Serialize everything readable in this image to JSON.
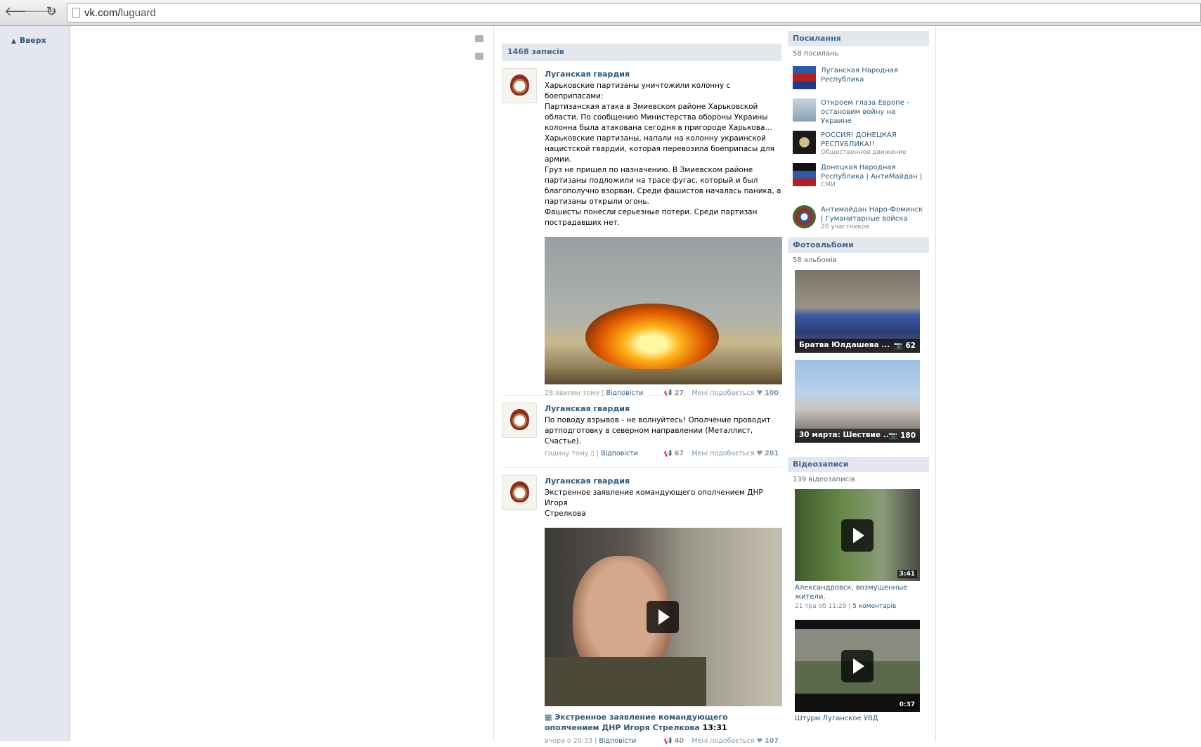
{
  "browser": {
    "url_host": "vk.com/",
    "url_path": "luguard",
    "back_glyph": "🡐",
    "forward_glyph": "🡒",
    "reload_glyph": "↻"
  },
  "left": {
    "up_label": "Вверх",
    "up_glyph": "▲"
  },
  "wall": {
    "count_label": "1468 записів",
    "posts": [
      {
        "author": "Луганская гвардия",
        "text": "Харьковские партизаны уничтожили колонну с боеприпасами:\nПартизанская атака в Змиевском районе Харьковской\nобласти. По сообщению Министерства обороны Украины\nколонна была атакована сегодня в пригороде Харькова…\nХарьковские партизаны, напали на колонну украинской\nнацистской гвардии, которая перевозила боеприпасы для\nармии.\nГруз не пришел по назначению. В Змиевском районе\nпартизаны подложили на трасе фугас, который и был\nблагополучно взорван. Среди фашистов началась паника, а\nпартизаны открыли огонь.\nФашисты понесли серьезные потери. Среди партизан\nпострадавших нет.",
        "time": "28 хвилин тому",
        "reply": "Відповісти",
        "shares": "27",
        "like_label": "Мені подобається",
        "likes": "100"
      },
      {
        "author": "Луганская гвардия",
        "text": "По поводу взрывов - не волнуйтесь! Ополчение проводит\nартподготовку в северном направлении (Металлист,\nСчастье).",
        "time": "годину тому",
        "reply": "Відповісти",
        "shares": "67",
        "like_label": "Мені подобається",
        "likes": "201"
      },
      {
        "author": "Луганская гвардия",
        "text": "Экстренное заявление командующего ополчением ДНР Игоря\nСтрелкова",
        "video_title": "Экстренное заявление командующего ополчением ДНР Игоря Стрелкова",
        "video_duration": "13:31",
        "time": "вчора о 20:33",
        "reply": "Відповісти",
        "shares": "40",
        "like_label": "Мені подобається",
        "likes": "107"
      }
    ]
  },
  "right": {
    "links_header": "Посилання",
    "links_count": "58 посилань",
    "links": [
      {
        "title": "Луганская Народная Республика",
        "sub": ""
      },
      {
        "title": "Откроем глаза Европе - остановим войну на Украине",
        "sub": ""
      },
      {
        "title": "РОССИЯ! ДОНЕЦКАЯ РЕСПУБЛИКА!!",
        "sub": "Общественное движение"
      },
      {
        "title": "Донецкая Народная Республика | АнтиМайдан |",
        "sub": "СМИ"
      },
      {
        "title": "Антимайдан Наро-Фоминск | Гуманитарные войска",
        "sub": "20 участников"
      }
    ],
    "albums_header": "Фотоальбоми",
    "albums_count": "58 альбомів",
    "albums": [
      {
        "title": "Братва Юлдашева ...",
        "count": "62"
      },
      {
        "title": "30 марта: Шествие ...",
        "count": "180"
      }
    ],
    "videos_header": "Відеозаписи",
    "videos_count": "139 відеозаписів",
    "videos": [
      {
        "duration": "3:41",
        "title": "Александровск, возмущенные жители.",
        "date": "21 тра об 11:29",
        "comments": "5 коментарів"
      },
      {
        "duration": "0:37",
        "title": "Штурм Луганское УВД",
        "date": "",
        "comments": ""
      }
    ]
  }
}
